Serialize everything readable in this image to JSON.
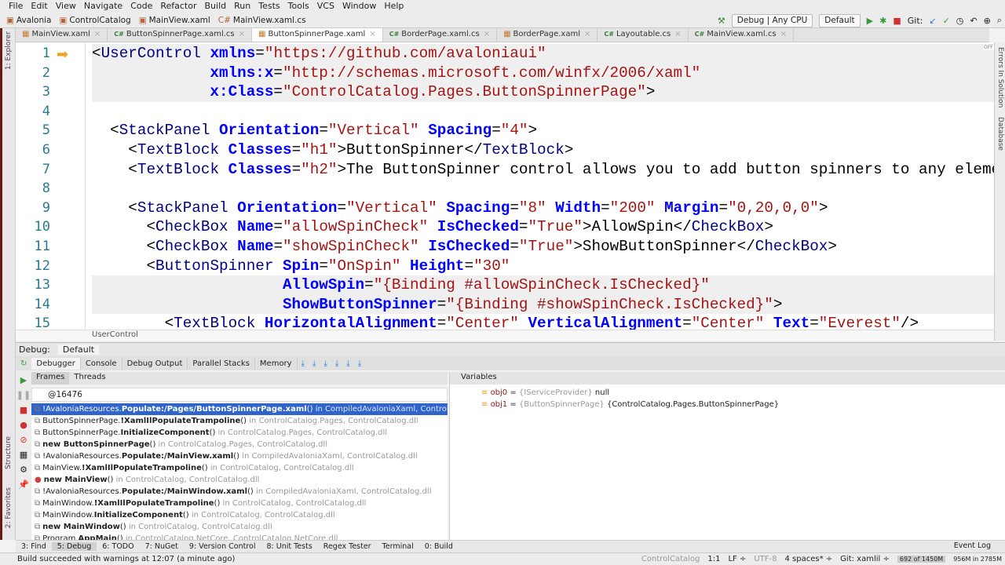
{
  "menu": [
    "File",
    "Edit",
    "View",
    "Navigate",
    "Code",
    "Refactor",
    "Build",
    "Run",
    "Tests",
    "Tools",
    "VCS",
    "Window",
    "Help"
  ],
  "breadcrumbs": [
    "Avalonia",
    "ControlCatalog",
    "MainView.xaml",
    "MainView.xaml.cs"
  ],
  "toolbar": {
    "config": "Debug | Any CPU",
    "profile": "Default",
    "git_label": "Git:"
  },
  "tabs": [
    {
      "label": "MainView.xaml",
      "kind": "xaml"
    },
    {
      "label": "ButtonSpinnerPage.xaml.cs",
      "kind": "cs"
    },
    {
      "label": "ButtonSpinnerPage.xaml",
      "kind": "xaml",
      "active": true
    },
    {
      "label": "BorderPage.xaml.cs",
      "kind": "cs"
    },
    {
      "label": "BorderPage.xaml",
      "kind": "xaml"
    },
    {
      "label": "Layoutable.cs",
      "kind": "cs"
    },
    {
      "label": "MainView.xaml.cs",
      "kind": "cs"
    }
  ],
  "side_left": {
    "explorer": "1: Explorer",
    "structure": "Structure",
    "favorites": "2: Favorites"
  },
  "side_right": {
    "errors": "Errors In Solution",
    "database": "Database",
    "off": "OFF"
  },
  "code_lines": [
    {
      "n": "1",
      "tokens": [
        [
          "p",
          "<"
        ],
        [
          "t",
          "UserControl"
        ],
        [
          "x",
          " "
        ],
        [
          "a",
          "xmlns"
        ],
        [
          "p",
          "="
        ],
        [
          "v",
          "\"https://github.com/avaloniaui\""
        ]
      ]
    },
    {
      "n": "2",
      "tokens": [
        [
          "x",
          "             "
        ],
        [
          "a",
          "xmlns:x"
        ],
        [
          "p",
          "="
        ],
        [
          "v",
          "\"http://schemas.microsoft.com/winfx/2006/xaml\""
        ]
      ]
    },
    {
      "n": "3",
      "tokens": [
        [
          "x",
          "             "
        ],
        [
          "a",
          "x:Class"
        ],
        [
          "p",
          "="
        ],
        [
          "v",
          "\"ControlCatalog.Pages.ButtonSpinnerPage\""
        ],
        [
          "p",
          ">"
        ]
      ]
    },
    {
      "n": "4",
      "tokens": []
    },
    {
      "n": "5",
      "tokens": [
        [
          "x",
          "  "
        ],
        [
          "p",
          "<"
        ],
        [
          "t",
          "StackPanel"
        ],
        [
          "x",
          " "
        ],
        [
          "a",
          "Orientation"
        ],
        [
          "p",
          "="
        ],
        [
          "v",
          "\"Vertical\""
        ],
        [
          "x",
          " "
        ],
        [
          "a",
          "Spacing"
        ],
        [
          "p",
          "="
        ],
        [
          "v",
          "\"4\""
        ],
        [
          "p",
          ">"
        ]
      ]
    },
    {
      "n": "6",
      "tokens": [
        [
          "x",
          "    "
        ],
        [
          "p",
          "<"
        ],
        [
          "t",
          "TextBlock"
        ],
        [
          "x",
          " "
        ],
        [
          "a",
          "Classes"
        ],
        [
          "p",
          "="
        ],
        [
          "v",
          "\"h1\""
        ],
        [
          "p",
          ">"
        ],
        [
          "x",
          "ButtonSpinner"
        ],
        [
          "p",
          "</"
        ],
        [
          "t",
          "TextBlock"
        ],
        [
          "p",
          ">"
        ]
      ]
    },
    {
      "n": "7",
      "tokens": [
        [
          "x",
          "    "
        ],
        [
          "p",
          "<"
        ],
        [
          "t",
          "TextBlock"
        ],
        [
          "x",
          " "
        ],
        [
          "a",
          "Classes"
        ],
        [
          "p",
          "="
        ],
        [
          "v",
          "\"h2\""
        ],
        [
          "p",
          ">"
        ],
        [
          "x",
          "The ButtonSpinner control allows you to add button spinners to any element"
        ]
      ]
    },
    {
      "n": "8",
      "tokens": []
    },
    {
      "n": "9",
      "tokens": [
        [
          "x",
          "    "
        ],
        [
          "p",
          "<"
        ],
        [
          "t",
          "StackPanel"
        ],
        [
          "x",
          " "
        ],
        [
          "a",
          "Orientation"
        ],
        [
          "p",
          "="
        ],
        [
          "v",
          "\"Vertical\""
        ],
        [
          "x",
          " "
        ],
        [
          "a",
          "Spacing"
        ],
        [
          "p",
          "="
        ],
        [
          "v",
          "\"8\""
        ],
        [
          "x",
          " "
        ],
        [
          "a",
          "Width"
        ],
        [
          "p",
          "="
        ],
        [
          "v",
          "\"200\""
        ],
        [
          "x",
          " "
        ],
        [
          "a",
          "Margin"
        ],
        [
          "p",
          "="
        ],
        [
          "v",
          "\"0,20,0,0\""
        ],
        [
          "p",
          ">"
        ]
      ]
    },
    {
      "n": "10",
      "tokens": [
        [
          "x",
          "      "
        ],
        [
          "p",
          "<"
        ],
        [
          "t",
          "CheckBox"
        ],
        [
          "x",
          " "
        ],
        [
          "a",
          "Name"
        ],
        [
          "p",
          "="
        ],
        [
          "v",
          "\"allowSpinCheck\""
        ],
        [
          "x",
          " "
        ],
        [
          "a",
          "IsChecked"
        ],
        [
          "p",
          "="
        ],
        [
          "v",
          "\"True\""
        ],
        [
          "p",
          ">"
        ],
        [
          "x",
          "AllowSpin"
        ],
        [
          "p",
          "</"
        ],
        [
          "t",
          "CheckBox"
        ],
        [
          "p",
          ">"
        ]
      ]
    },
    {
      "n": "11",
      "tokens": [
        [
          "x",
          "      "
        ],
        [
          "p",
          "<"
        ],
        [
          "t",
          "CheckBox"
        ],
        [
          "x",
          " "
        ],
        [
          "a",
          "Name"
        ],
        [
          "p",
          "="
        ],
        [
          "v",
          "\"showSpinCheck\""
        ],
        [
          "x",
          " "
        ],
        [
          "a",
          "IsChecked"
        ],
        [
          "p",
          "="
        ],
        [
          "v",
          "\"True\""
        ],
        [
          "p",
          ">"
        ],
        [
          "x",
          "ShowButtonSpinner"
        ],
        [
          "p",
          "</"
        ],
        [
          "t",
          "CheckBox"
        ],
        [
          "p",
          ">"
        ]
      ]
    },
    {
      "n": "12",
      "tokens": [
        [
          "x",
          "      "
        ],
        [
          "p",
          "<"
        ],
        [
          "t",
          "ButtonSpinner"
        ],
        [
          "x",
          " "
        ],
        [
          "a",
          "Spin"
        ],
        [
          "p",
          "="
        ],
        [
          "v",
          "\"OnSpin\""
        ],
        [
          "x",
          " "
        ],
        [
          "a",
          "Height"
        ],
        [
          "p",
          "="
        ],
        [
          "v",
          "\"30\""
        ]
      ]
    },
    {
      "n": "13",
      "tokens": [
        [
          "x",
          "                     "
        ],
        [
          "a",
          "AllowSpin"
        ],
        [
          "p",
          "="
        ],
        [
          "v",
          "\"{Binding #allowSpinCheck.IsChecked}\""
        ]
      ]
    },
    {
      "n": "14",
      "tokens": [
        [
          "x",
          "                     "
        ],
        [
          "a",
          "ShowButtonSpinner"
        ],
        [
          "p",
          "="
        ],
        [
          "v",
          "\"{Binding #showSpinCheck.IsChecked}\""
        ],
        [
          "p",
          ">"
        ]
      ]
    },
    {
      "n": "15",
      "tokens": [
        [
          "x",
          "        "
        ],
        [
          "p",
          "<"
        ],
        [
          "t",
          "TextBlock"
        ],
        [
          "x",
          " "
        ],
        [
          "a",
          "HorizontalAlignment"
        ],
        [
          "p",
          "="
        ],
        [
          "v",
          "\"Center\""
        ],
        [
          "x",
          " "
        ],
        [
          "a",
          "VerticalAlignment"
        ],
        [
          "p",
          "="
        ],
        [
          "v",
          "\"Center\""
        ],
        [
          "x",
          " "
        ],
        [
          "a",
          "Text"
        ],
        [
          "p",
          "="
        ],
        [
          "v",
          "\"Everest\""
        ],
        [
          "p",
          "/>"
        ]
      ]
    }
  ],
  "editor_breadcrumb": "UserControl",
  "debug": {
    "label": "Debug:",
    "session": "Default",
    "tabs": [
      "Debugger",
      "Console",
      "Debug Output",
      "Parallel Stacks",
      "Memory"
    ],
    "frames_tab": "Frames",
    "threads_tab": "Threads",
    "thread": "@16476",
    "frames": [
      {
        "pre": "!AvaloniaResources.",
        "bold": "Populate:/Pages/ButtonSpinnerPage.xaml",
        "post": "()",
        "loc": " in CompiledAvaloniaXaml, ControlCatalog.dll",
        "selected": true
      },
      {
        "pre": "ButtonSpinnerPage.",
        "bold": "!XamlIlPopulateTrampoline",
        "post": "()",
        "loc": " in ControlCatalog.Pages, ControlCatalog.dll"
      },
      {
        "pre": "ButtonSpinnerPage.",
        "bold": "InitializeComponent",
        "post": "()",
        "loc": " in ControlCatalog.Pages, ControlCatalog.dll"
      },
      {
        "pre": "",
        "bold": "new ButtonSpinnerPage",
        "post": "()",
        "loc": " in ControlCatalog.Pages, ControlCatalog.dll"
      },
      {
        "pre": "!AvaloniaResources.",
        "bold": "Populate:/MainView.xaml",
        "post": "()",
        "loc": " in CompiledAvaloniaXaml, ControlCatalog.dll"
      },
      {
        "pre": "MainView.",
        "bold": "!XamlIlPopulateTrampoline",
        "post": "()",
        "loc": " in ControlCatalog, ControlCatalog.dll"
      },
      {
        "pre": "",
        "bold": "new MainView",
        "post": "()",
        "loc": " in ControlCatalog, ControlCatalog.dll",
        "breakpoint": true
      },
      {
        "pre": "!AvaloniaResources.",
        "bold": "Populate:/MainWindow.xaml",
        "post": "()",
        "loc": " in CompiledAvaloniaXaml, ControlCatalog.dll"
      },
      {
        "pre": "MainWindow.",
        "bold": "!XamlIlPopulateTrampoline",
        "post": "()",
        "loc": " in ControlCatalog, ControlCatalog.dll"
      },
      {
        "pre": "MainWindow.",
        "bold": "InitializeComponent",
        "post": "()",
        "loc": " in ControlCatalog, ControlCatalog.dll"
      },
      {
        "pre": "",
        "bold": "new MainWindow",
        "post": "()",
        "loc": " in ControlCatalog, ControlCatalog.dll"
      },
      {
        "pre": "Program.",
        "bold": "AppMain",
        "post": "()",
        "loc": " in ControlCatalog.NetCore, ControlCatalog.NetCore.dll"
      }
    ],
    "variables_title": "Variables",
    "variables": [
      {
        "name": "obj0",
        "type": "{IServiceProvider}",
        "value": "null"
      },
      {
        "name": "obj1",
        "type": "{ButtonSpinnerPage}",
        "value": "{ControlCatalog.Pages.ButtonSpinnerPage}"
      }
    ]
  },
  "bottom_tabs": [
    "3: Find",
    "5: Debug",
    "6: TODO",
    "7: NuGet",
    "9: Version Control",
    "8: Unit Tests",
    "Regex Tester",
    "Terminal",
    "0: Build"
  ],
  "event_log": "Event Log",
  "status": {
    "message": "Build succeeded with warnings at 12:07 (a minute ago)",
    "project": "ControlCatalog",
    "position": "1:1",
    "line_ending": "LF ÷",
    "encoding": "UTF-8",
    "indent": "4 spaces* ÷",
    "git": "Git: xamlil ÷",
    "memory": "692 of 1450M",
    "memory2": "956M in 2785M"
  }
}
